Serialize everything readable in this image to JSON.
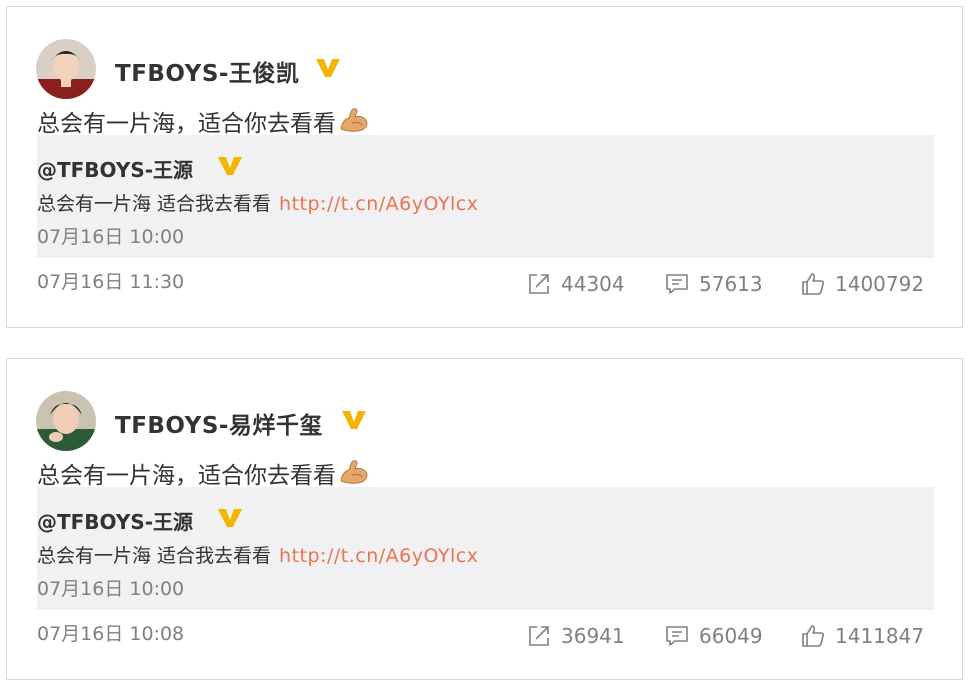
{
  "posts": [
    {
      "author": "TFBOYS-王俊凯",
      "text": "总会有一片海，适合你去看看",
      "emoji_icon": "flexed-biceps-icon",
      "quoted": {
        "author": "@TFBOYS-王源",
        "text": "总会有一片海 适合我去看看",
        "link": "http://t.cn/A6yOYlcx",
        "time": "07月16日 10:00"
      },
      "time": "07月16日 11:30",
      "stats": {
        "share": "44304",
        "comment": "57613",
        "like": "1400792"
      }
    },
    {
      "author": "TFBOYS-易烊千玺",
      "text": "总会有一片海，适合你去看看",
      "emoji_icon": "flexed-biceps-icon",
      "quoted": {
        "author": "@TFBOYS-王源",
        "text": "总会有一片海 适合我去看看",
        "link": "http://t.cn/A6yOYlcx",
        "time": "07月16日 10:00"
      },
      "time": "07月16日 10:08",
      "stats": {
        "share": "36941",
        "comment": "66049",
        "like": "1411847"
      }
    }
  ],
  "colors": {
    "verified_badge": "#f4b400",
    "link": "#eb7350",
    "quote_bg": "#f1f1f4",
    "muted": "#808080"
  }
}
